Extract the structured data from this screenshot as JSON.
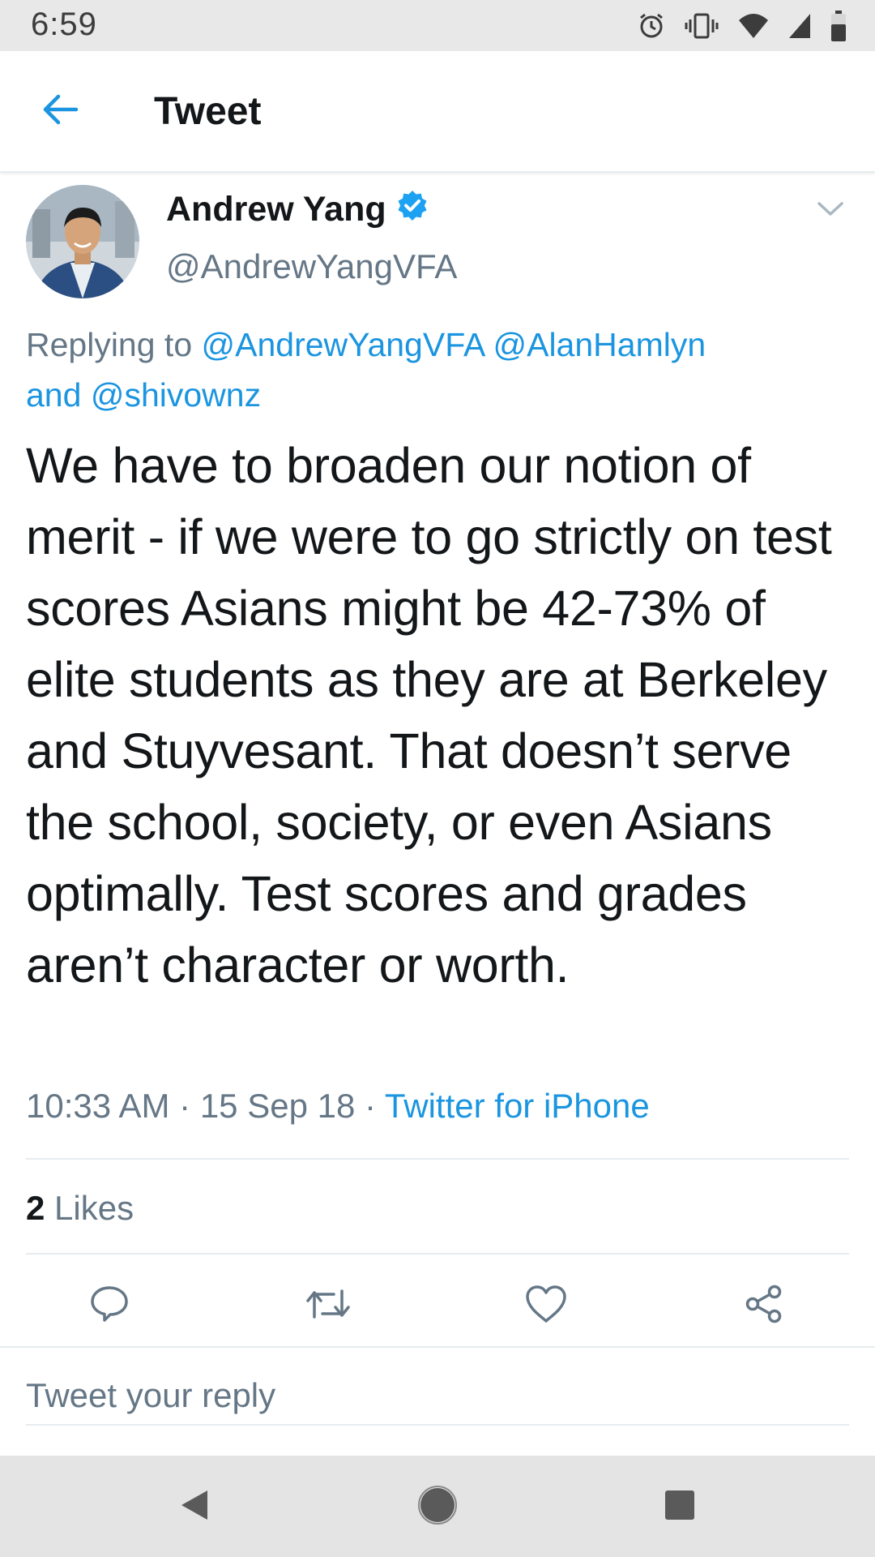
{
  "status_bar": {
    "time": "6:59",
    "icons": [
      "alarm-icon",
      "vibrate-icon",
      "wifi-icon",
      "signal-icon",
      "battery-icon"
    ]
  },
  "app_bar": {
    "title": "Tweet",
    "back_icon": "arrow-left-icon"
  },
  "tweet": {
    "author_name": "Andrew Yang",
    "verified": true,
    "handle": "@AndrewYangVFA",
    "replying_prefix": "Replying to ",
    "mention_1": "@AndrewYangVFA",
    "mention_2": "@AlanHamlyn",
    "replying_and": "and",
    "mention_3": "@shivownz",
    "text": "We have to broaden our notion of merit - if we were to go strictly on test scores Asians might be 42-73% of elite students as they are at Berkeley and Stuyvesant. That doesn’t serve the school, society, or even Asians optimally. Test scores and grades aren’t character or worth.",
    "time": "10:33 AM",
    "date": "15 Sep 18",
    "separator": "·",
    "source": "Twitter for iPhone",
    "likes_count": "2",
    "likes_label": "Likes"
  },
  "actions": [
    "reply-icon",
    "retweet-icon",
    "like-icon",
    "share-icon"
  ],
  "reply": {
    "placeholder": "Tweet your reply"
  },
  "colors": {
    "accent": "#1b95e0",
    "text_primary": "#14171a",
    "text_secondary": "#657786",
    "divider": "#e6ecf0"
  }
}
